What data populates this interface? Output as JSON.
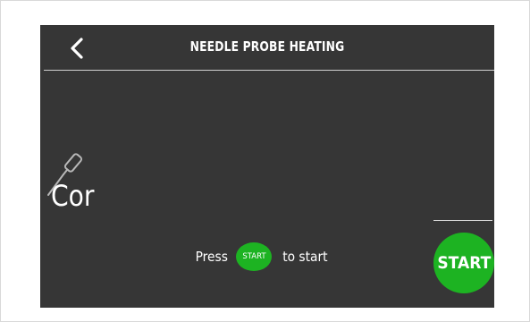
{
  "header": {
    "title": "NEEDLE PROBE HEATING",
    "back_icon": "chevron-left-icon"
  },
  "main": {
    "probe_icon": "needle-probe-icon",
    "reading": "Cor"
  },
  "hint": {
    "prefix": "Press",
    "button_label": "START",
    "suffix": "to start"
  },
  "controls": {
    "start_label": "START"
  },
  "colors": {
    "screen_background": "#363636",
    "accent_green": "#1db322",
    "text": "#ffffff"
  }
}
